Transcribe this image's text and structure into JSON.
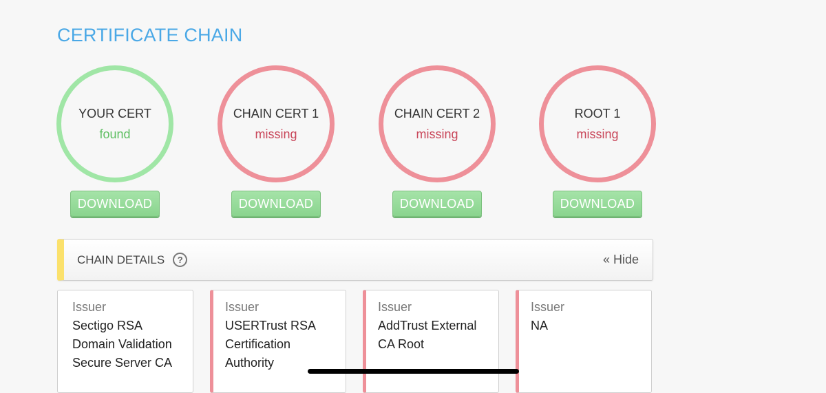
{
  "page": {
    "title": "CERTIFICATE CHAIN"
  },
  "certs": [
    {
      "name": "YOUR CERT",
      "status": "found",
      "download_label": "DOWNLOAD"
    },
    {
      "name": "CHAIN CERT 1",
      "status": "missing",
      "download_label": "DOWNLOAD"
    },
    {
      "name": "CHAIN CERT 2",
      "status": "missing",
      "download_label": "DOWNLOAD"
    },
    {
      "name": "ROOT 1",
      "status": "missing",
      "download_label": "DOWNLOAD"
    }
  ],
  "chain_details": {
    "label": "CHAIN DETAILS",
    "help_icon": "?",
    "hide_label": "« Hide"
  },
  "issuers": [
    {
      "label": "Issuer",
      "value": "Sectigo RSA Domain Validation Secure Server CA"
    },
    {
      "label": "Issuer",
      "value": "USERTrust RSA Certification Authority"
    },
    {
      "label": "Issuer",
      "value": "AddTrust External CA Root"
    },
    {
      "label": "Issuer",
      "value": "NA"
    }
  ],
  "colors": {
    "title": "#4aa8e6",
    "found_ring": "#a0e6a6",
    "missing_ring": "#ee9099",
    "found_text": "#5fbf63",
    "missing_text": "#c9485b",
    "download_button": "#8ad48e",
    "details_accent": "#fbe16c"
  }
}
